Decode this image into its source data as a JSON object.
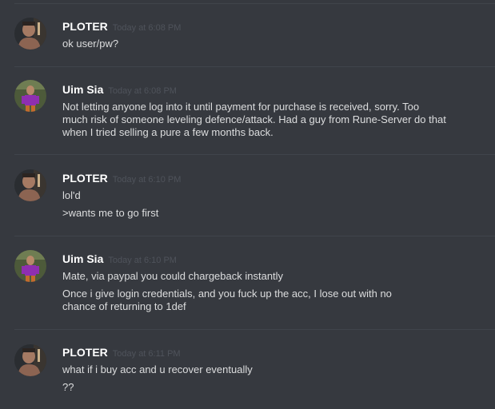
{
  "messages": [
    {
      "author": "PLOTER",
      "timestamp": "Today at 6:08 PM",
      "avatar_icon": "bald-man-avatar-icon",
      "lines": [
        "ok user/pw?"
      ]
    },
    {
      "author": "Uim Sia",
      "timestamp": "Today at 6:08 PM",
      "avatar_icon": "purple-character-avatar-icon",
      "lines": [
        "Not letting anyone log into it until payment for purchase is received, sorry. Too",
        "much risk of someone leveling defence/attack. Had a guy from Rune-Server do that",
        "when I tried selling a pure a few months back."
      ]
    },
    {
      "author": "PLOTER",
      "timestamp": "Today at 6:10 PM",
      "avatar_icon": "bald-man-avatar-icon",
      "lines": [
        "lol'd",
        ">wants me to go first"
      ]
    },
    {
      "author": "Uim Sia",
      "timestamp": "Today at 6:10 PM",
      "avatar_icon": "purple-character-avatar-icon",
      "lines": [
        "Mate, via paypal you could chargeback instantly",
        "Once i give login credentials, and you fuck up the acc, I lose out with no",
        "chance of returning to 1def"
      ]
    },
    {
      "author": "PLOTER",
      "timestamp": "Today at 6:11 PM",
      "avatar_icon": "bald-man-avatar-icon",
      "lines": [
        "what if i buy acc and u recover eventually",
        "??"
      ]
    }
  ],
  "colors": {
    "background": "#36393f",
    "divider": "#40444b",
    "username": "#ffffff",
    "timestamp": "#4f535b",
    "text": "#dcddde"
  }
}
